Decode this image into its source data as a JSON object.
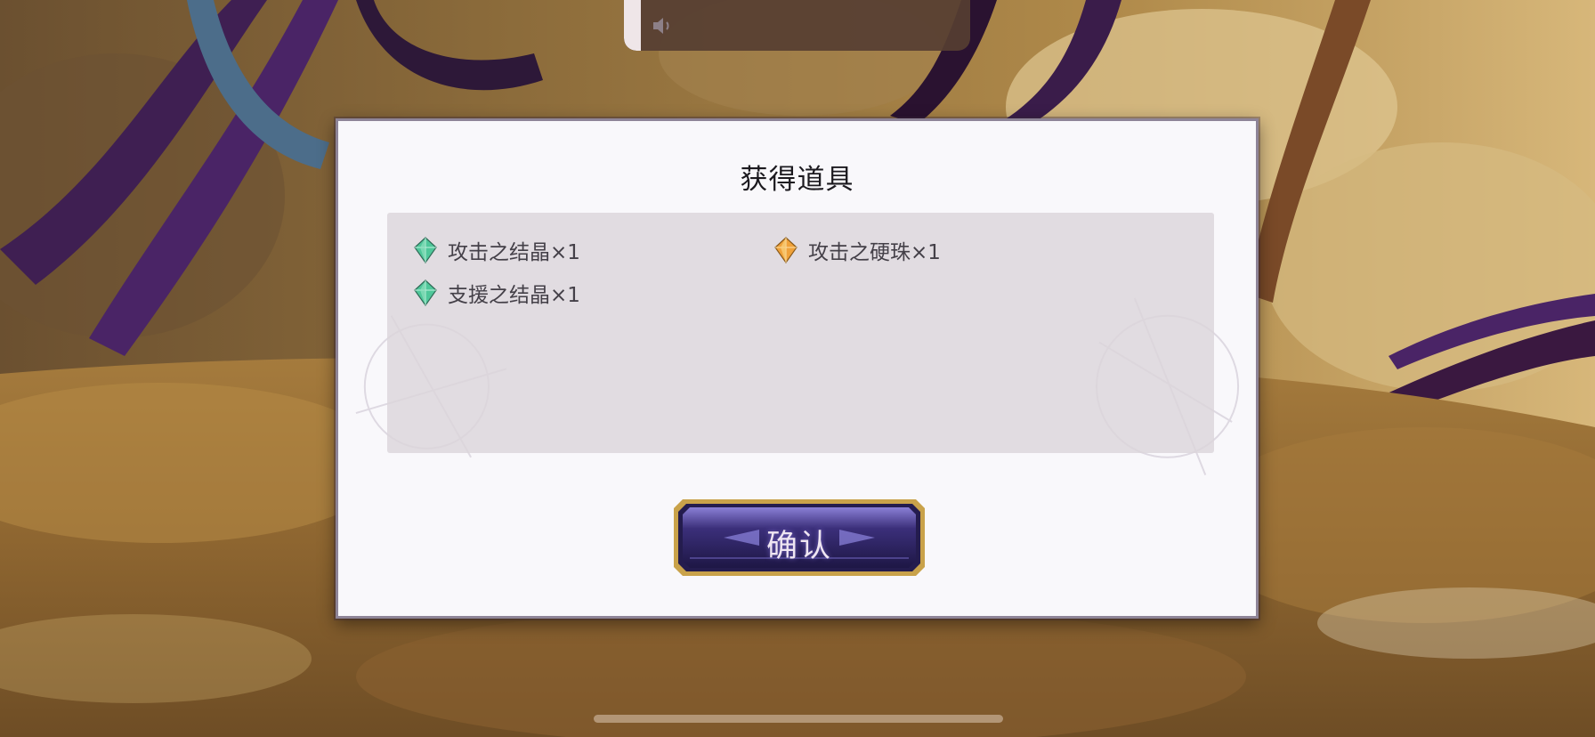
{
  "volume": {
    "level": 0.05,
    "icon": "speaker-icon"
  },
  "dialog": {
    "title": "获得道具",
    "items": [
      {
        "label": "攻击之结晶×1",
        "icon": "green-crystal-icon",
        "color": "#4fc79a"
      },
      {
        "label": "攻击之硬珠×1",
        "icon": "orange-crystal-icon",
        "color": "#f0a23a"
      },
      {
        "label": "支援之结晶×1",
        "icon": "green-crystal-icon",
        "color": "#4fc79a"
      }
    ],
    "confirm_label": "确认"
  },
  "colors": {
    "dialog_bg": "#f9f8fb",
    "panel_bg": "#dcd5db",
    "button_purple": "#3b2f7a",
    "button_gold": "#c9a24a"
  }
}
